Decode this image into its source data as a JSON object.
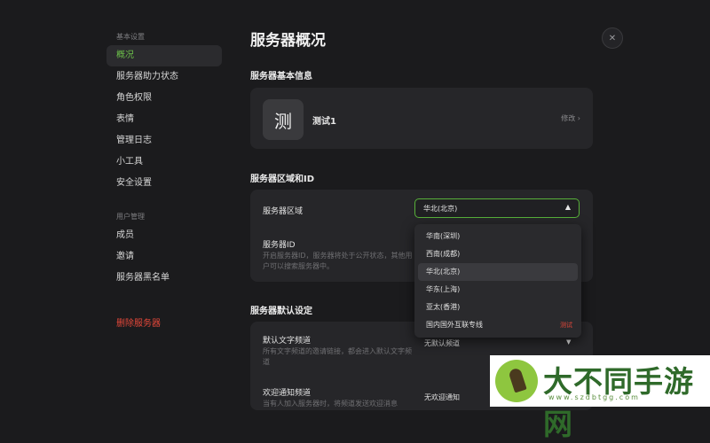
{
  "sidebar": {
    "section1": "基本设置",
    "items1": [
      "概况",
      "服务器助力状态",
      "角色权限",
      "表情",
      "管理日志",
      "小工具",
      "安全设置"
    ],
    "section2": "用户管理",
    "items2": [
      "成员",
      "邀请",
      "服务器黑名单"
    ],
    "danger": "删除服务器"
  },
  "page": {
    "title": "服务器概况",
    "close_icon": "✕"
  },
  "basic": {
    "heading": "服务器基本信息",
    "avatar_char": "测",
    "name": "测试1",
    "edit": "修改 ›"
  },
  "region": {
    "heading": "服务器区域和ID",
    "region_label": "服务器区域",
    "region_value": "华北(北京)",
    "id_label": "服务器ID",
    "id_desc": "开启服务器ID，服务器将处于公开状态，其他用户可以搜索服务器中。",
    "options": [
      "华南(深圳)",
      "西南(成都)",
      "华北(北京)",
      "华东(上海)",
      "亚太(香港)",
      "国内国外互联专线"
    ],
    "option_tag": "测试",
    "selected_index": 2
  },
  "defaults": {
    "heading": "服务器默认设定",
    "text_label": "默认文字频道",
    "text_desc": "所有文字频道的邀请链接，都会进入默认文字频道",
    "text_value": "无默认频道",
    "welcome_label": "欢迎通知频道",
    "welcome_desc": "当有人加入服务器时，将频道发送欢迎消息",
    "welcome_value": "无欢迎通知"
  },
  "watermark": {
    "text": "大不同手游网",
    "url": "www.szdbtgg.com"
  }
}
